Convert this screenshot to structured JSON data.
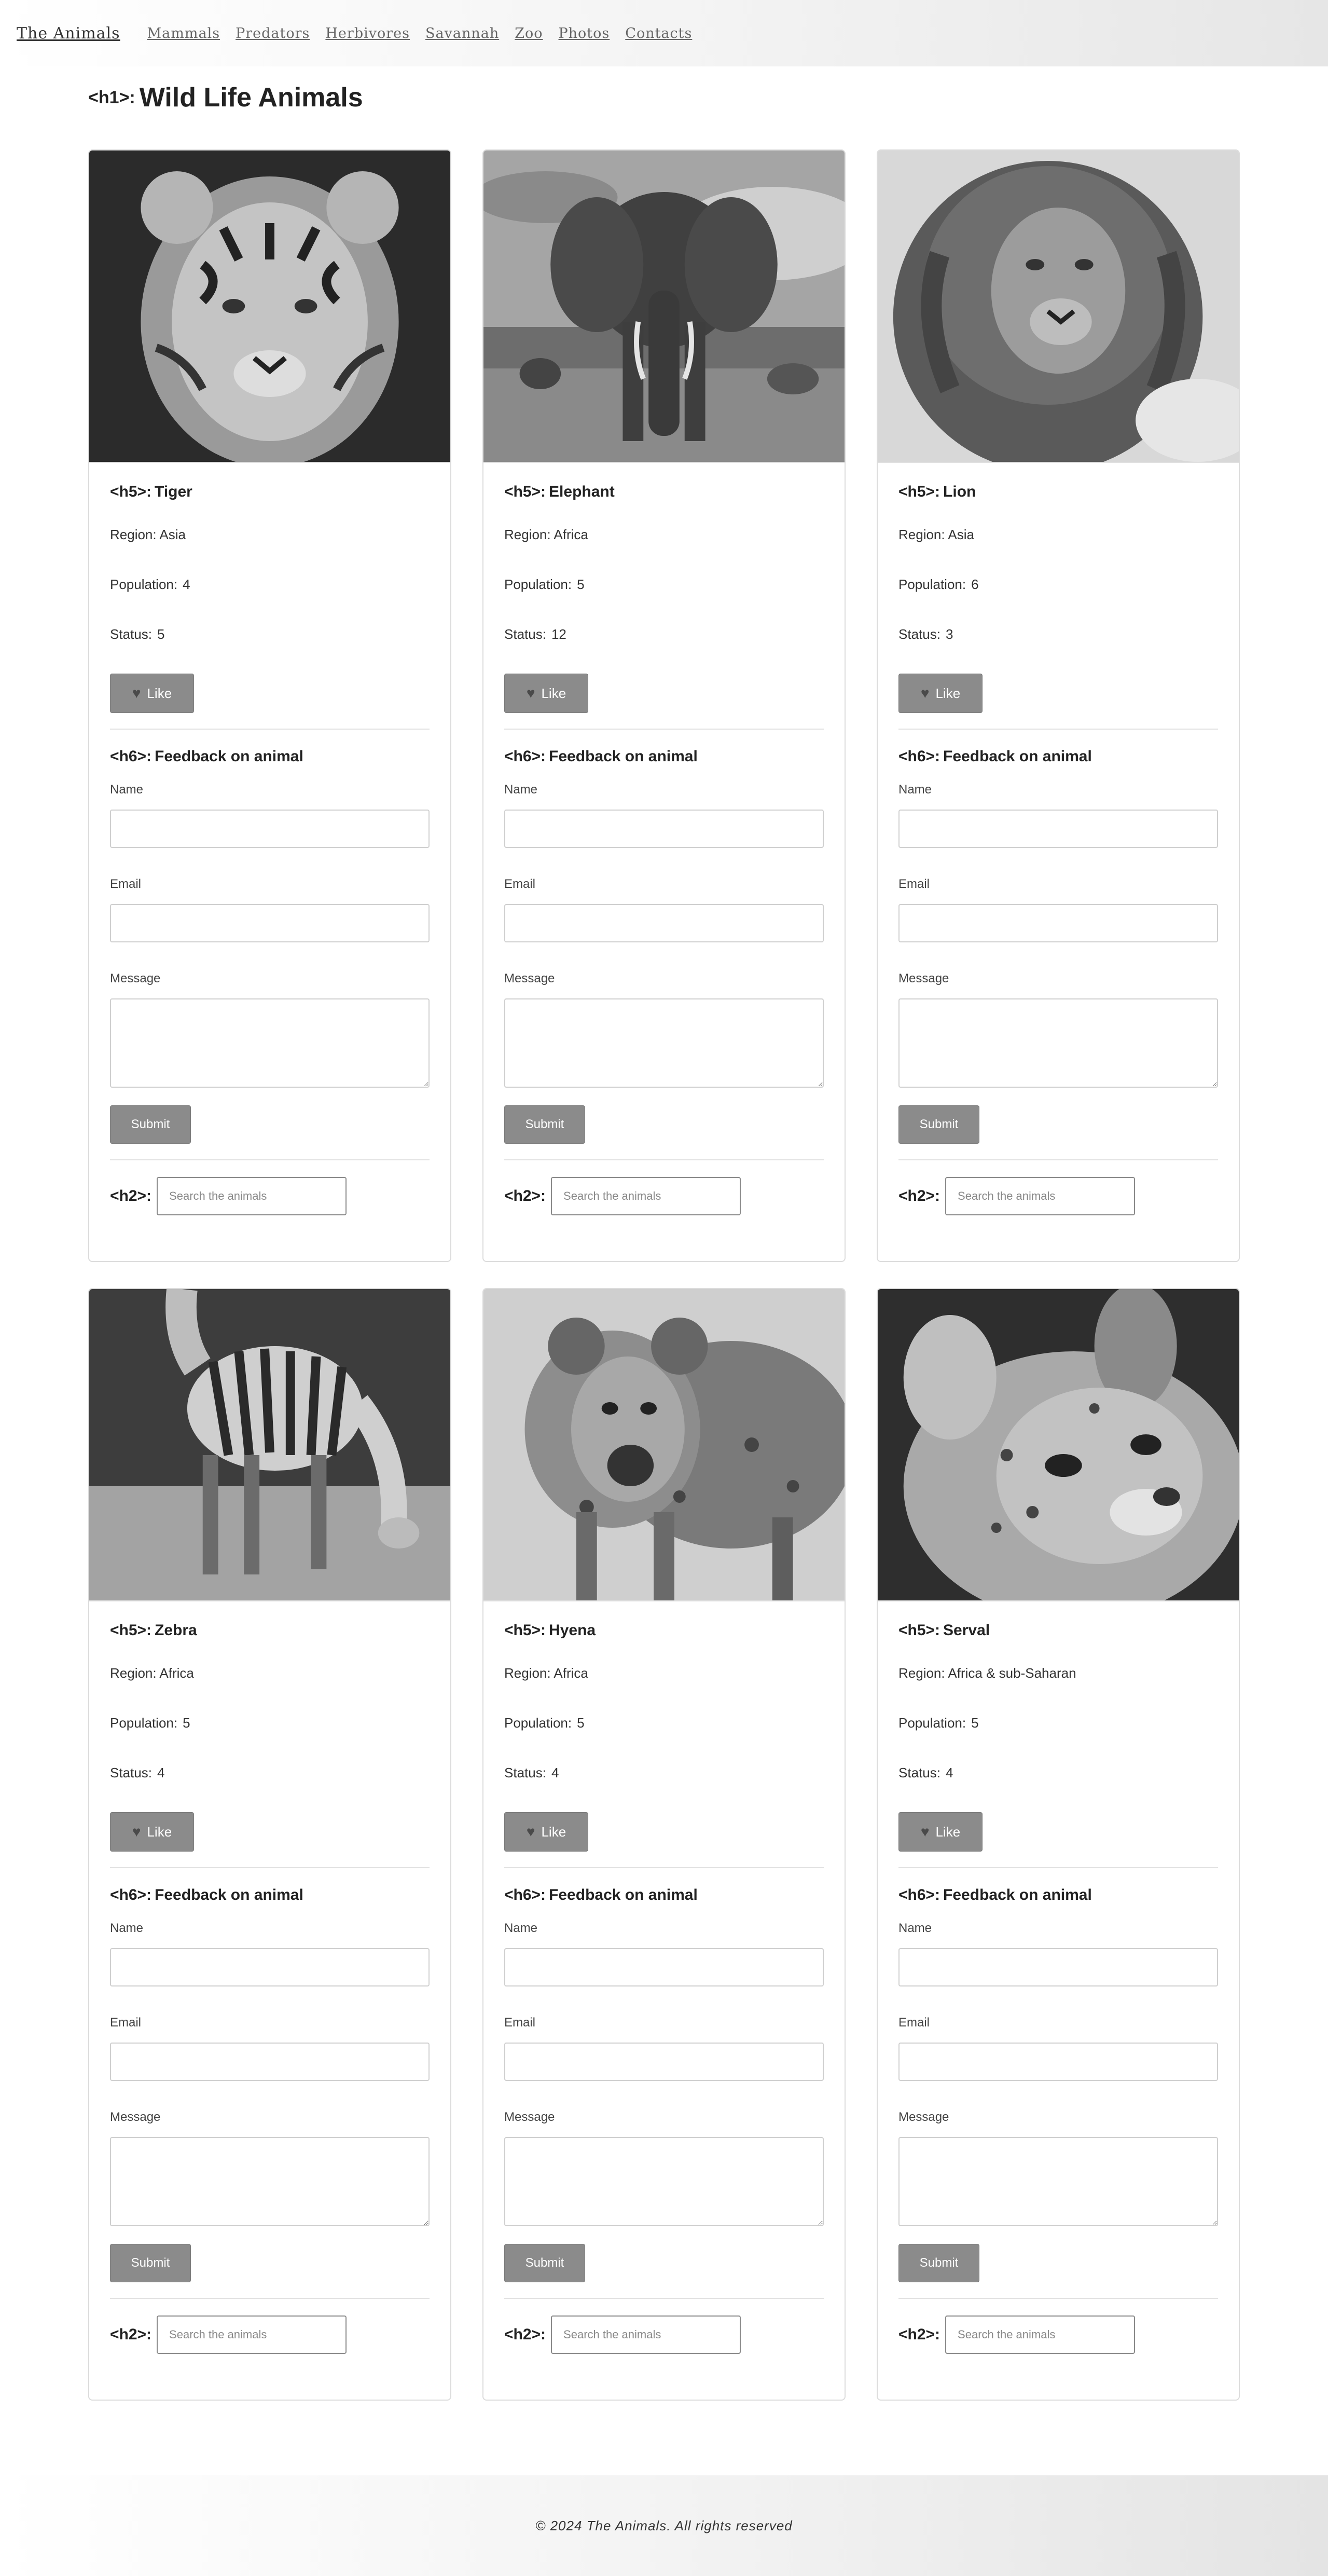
{
  "nav": {
    "brand": "The Animals",
    "links": [
      "Mammals",
      "Predators",
      "Herbivores",
      "Savannah",
      "Zoo",
      "Photos",
      "Contacts"
    ]
  },
  "page": {
    "title_tag": "<h1>:",
    "title": "Wild Life Animals"
  },
  "labels": {
    "card_title_tag": "<h5>:",
    "form_title_tag": "<h6>:",
    "search_tag": "<h2>:",
    "heart_symbol": "♥",
    "like_label": "Like",
    "form_title": "Feedback on animal",
    "name_label": "Name",
    "email_label": "Email",
    "message_label": "Message",
    "submit_label": "Submit",
    "search_placeholder": "Search the animals"
  },
  "cards": [
    {
      "name": "Tiger",
      "region": "Region: Asia",
      "population_label": "Population:",
      "population": "4",
      "status_label": "Status:",
      "status": "5",
      "image_icon": "tiger-photo"
    },
    {
      "name": "Elephant",
      "region": "Region: Africa",
      "population_label": "Population:",
      "population": "5",
      "status_label": "Status:",
      "status": "12",
      "image_icon": "elephant-photo"
    },
    {
      "name": "Lion",
      "region": "Region: Asia",
      "population_label": "Population:",
      "population": "6",
      "status_label": "Status:",
      "status": "3",
      "image_icon": "lion-photo"
    },
    {
      "name": "Zebra",
      "region": "Region: Africa",
      "population_label": "Population:",
      "population": "5",
      "status_label": "Status:",
      "status": "4",
      "image_icon": "zebra-photo"
    },
    {
      "name": "Hyena",
      "region": "Region: Africa",
      "population_label": "Population:",
      "population": "5",
      "status_label": "Status:",
      "status": "4",
      "image_icon": "hyena-photo"
    },
    {
      "name": "Serval",
      "region": "Region: Africa & sub-Saharan",
      "population_label": "Population:",
      "population": "5",
      "status_label": "Status:",
      "status": "4",
      "image_icon": "serval-photo"
    }
  ],
  "footer": {
    "text": "© 2024 The Animals. All rights reserved"
  },
  "colors": {
    "button_gray": "#8b8b8b",
    "border_gray": "#dcdcdc",
    "text_dark": "#222222"
  }
}
